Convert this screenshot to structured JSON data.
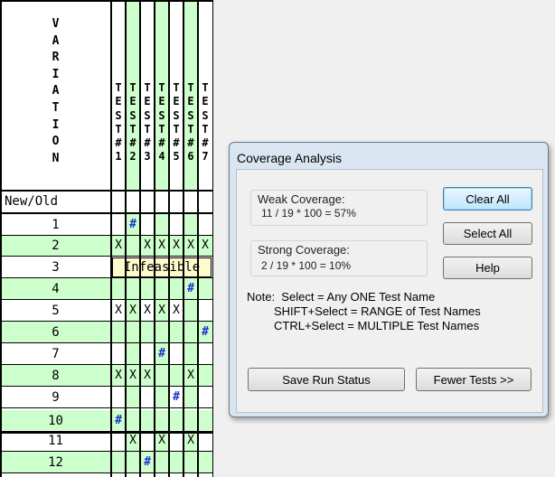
{
  "grid": {
    "header_label": "VARIATION",
    "new_old_label": "New/Old",
    "tests": [
      "TEST#1",
      "TEST#2",
      "TEST#3",
      "TEST#4",
      "TEST#5",
      "TEST#6",
      "TEST#7"
    ],
    "rows": [
      {
        "num": "1",
        "marks": [
          "",
          "#",
          "",
          "",
          "",
          "",
          ""
        ]
      },
      {
        "num": "2",
        "marks": [
          "X",
          "",
          "X",
          "X",
          "X",
          "X",
          "X"
        ]
      },
      {
        "num": "3",
        "infeasible": "Infeasible"
      },
      {
        "num": "4",
        "marks": [
          "",
          "",
          "",
          "",
          "",
          "#",
          ""
        ]
      },
      {
        "num": "5",
        "marks": [
          "X",
          "X",
          "X",
          "X",
          "X",
          "",
          ""
        ]
      },
      {
        "num": "6",
        "marks": [
          "",
          "",
          "",
          "",
          "",
          "",
          "#"
        ]
      },
      {
        "num": "7",
        "marks": [
          "",
          "",
          "",
          "#",
          "",
          "",
          ""
        ]
      },
      {
        "num": "8",
        "marks": [
          "X",
          "X",
          "X",
          "",
          "",
          "X",
          ""
        ]
      },
      {
        "num": "9",
        "marks": [
          "",
          "",
          "",
          "",
          "#",
          "",
          ""
        ]
      },
      {
        "num": "10",
        "marks": [
          "#",
          "",
          "",
          "",
          "",
          "",
          ""
        ]
      },
      {
        "num": "11",
        "marks": [
          "",
          "X",
          "",
          "X",
          "",
          "X",
          ""
        ]
      },
      {
        "num": "12",
        "marks": [
          "",
          "",
          "#",
          "",
          "",
          "",
          ""
        ]
      }
    ],
    "colors": {
      "green": "#ccffcc",
      "white": "#ffffff",
      "hash": "#1e2fd0",
      "infeasible_bg": "#fffacd"
    }
  },
  "dialog": {
    "title": "Coverage Analysis",
    "weak_label": "Weak Coverage:",
    "weak_value": "11 / 19 * 100 = 57%",
    "strong_label": "Strong Coverage:",
    "strong_value": "2 / 19 * 100 = 10%",
    "clear_all": "Clear All",
    "select_all": "Select All",
    "help": "Help",
    "note_line1": "Note:  Select = Any ONE Test Name",
    "note_line2": "SHIFT+Select = RANGE of Test Names",
    "note_line3": "CTRL+Select = MULTIPLE Test Names",
    "save_run_status": "Save Run Status",
    "fewer_tests": "Fewer Tests >>"
  }
}
